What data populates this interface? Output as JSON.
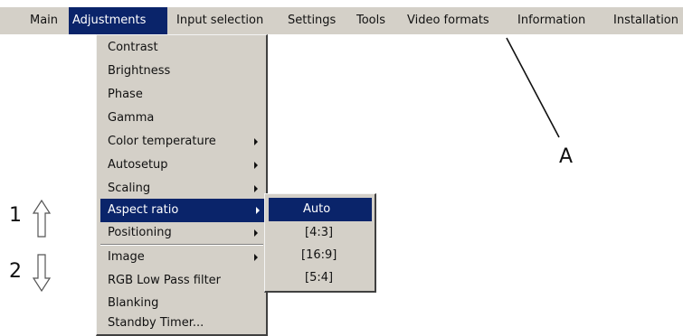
{
  "menubar": {
    "items": [
      {
        "label": "Main"
      },
      {
        "label": "Adjustments"
      },
      {
        "label": "Input selection"
      },
      {
        "label": "Settings"
      },
      {
        "label": "Tools"
      },
      {
        "label": "Video formats"
      },
      {
        "label": "Information"
      },
      {
        "label": "Installation"
      }
    ]
  },
  "adjustments_menu": {
    "items": [
      {
        "label": "Contrast"
      },
      {
        "label": "Brightness"
      },
      {
        "label": "Phase"
      },
      {
        "label": "Gamma"
      },
      {
        "label": "Color temperature"
      },
      {
        "label": "Autosetup"
      },
      {
        "label": "Scaling"
      },
      {
        "label": "Aspect ratio"
      },
      {
        "label": "Positioning"
      },
      {
        "label": "Image"
      },
      {
        "label": "RGB Low Pass filter"
      },
      {
        "label": "Blanking"
      },
      {
        "label": "Standby Timer..."
      }
    ]
  },
  "aspect_ratio_submenu": {
    "items": [
      {
        "label": "Auto"
      },
      {
        "label": "[4:3]"
      },
      {
        "label": "[16:9]"
      },
      {
        "label": "[5:4]"
      }
    ]
  },
  "annotations": {
    "a": "A",
    "one": "1",
    "two": "2"
  },
  "icons": [
    "arrow-up-outline-icon",
    "arrow-down-outline-icon",
    "submenu-arrow-icon"
  ],
  "colors": {
    "menu_background": "#d4d0c8",
    "selection": "#0a246a",
    "selection_text": "#ffffff"
  }
}
